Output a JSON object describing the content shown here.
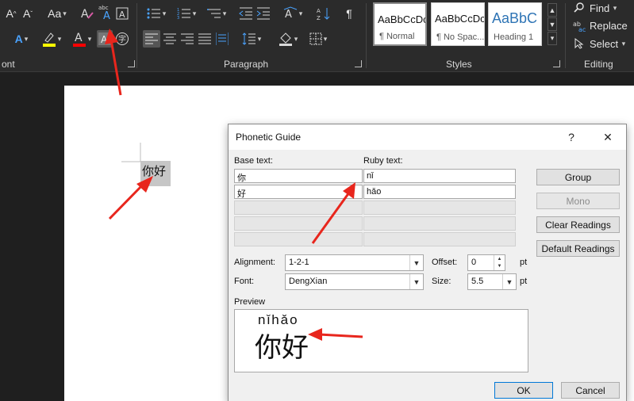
{
  "ribbon": {
    "font_group_label": "ont",
    "paragraph_group_label": "Paragraph",
    "styles_group_label": "Styles",
    "editing_group_label": "Editing",
    "change_case_label": "Aa",
    "styles": [
      {
        "sample": "AaBbCcDc",
        "name": "¶ Normal"
      },
      {
        "sample": "AaBbCcDc",
        "name": "¶ No Spac..."
      },
      {
        "sample": "AaBbC",
        "name": "Heading 1"
      }
    ],
    "editing": {
      "find": "Find",
      "replace": "Replace",
      "select": "Select"
    }
  },
  "document": {
    "selected_text": "你好"
  },
  "dialog": {
    "title": "Phonetic Guide",
    "help": "?",
    "close": "✕",
    "base_text_label": "Base text:",
    "ruby_text_label": "Ruby text:",
    "rows": [
      {
        "base": "你",
        "ruby": "nǐ"
      },
      {
        "base": "好",
        "ruby": "hǎo"
      }
    ],
    "buttons": {
      "group": "Group",
      "mono": "Mono",
      "clear_readings": "Clear Readings",
      "default_readings": "Default Readings",
      "ok": "OK",
      "cancel": "Cancel"
    },
    "alignment_label": "Alignment:",
    "alignment_value": "1-2-1",
    "offset_label": "Offset:",
    "offset_value": "0",
    "offset_unit": "pt",
    "font_label": "Font:",
    "font_value": "DengXian",
    "size_label": "Size:",
    "size_value": "5.5",
    "size_unit": "pt",
    "preview_label": "Preview",
    "preview_ruby": "nǐhǎo",
    "preview_base": "你好"
  },
  "colors": {
    "highlight": "#ffff00",
    "font_color": "#ff0000",
    "annotation_arrow": "#e8261d",
    "title_accent": "#2e74b5"
  }
}
